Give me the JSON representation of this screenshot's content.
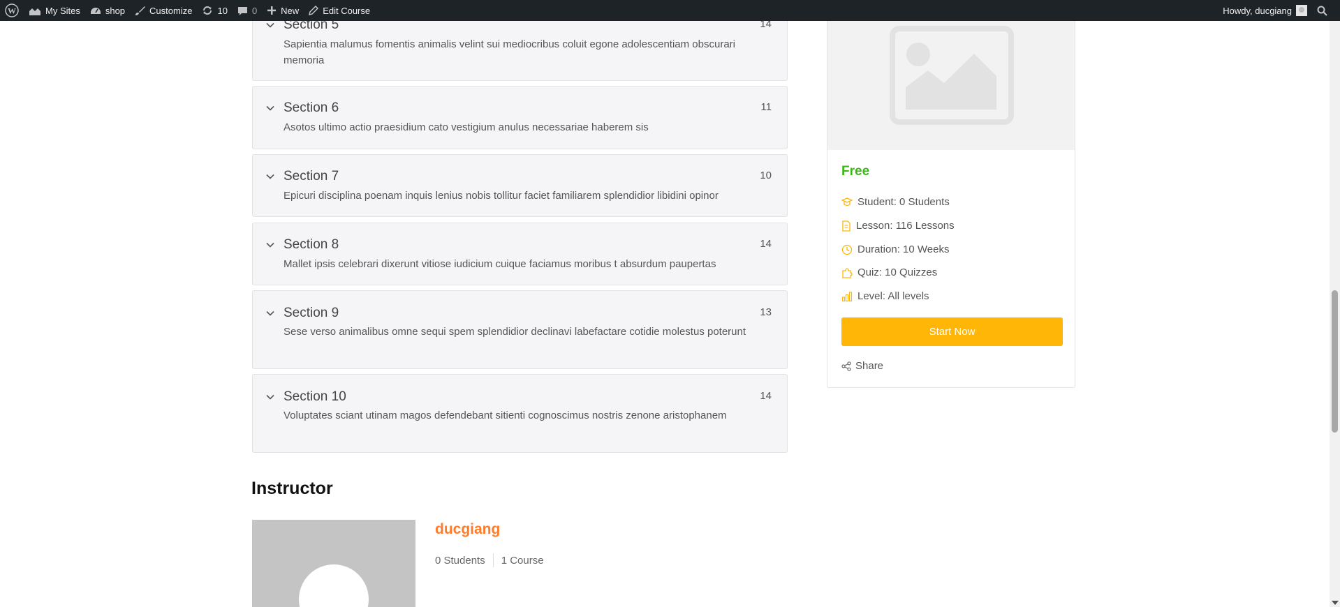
{
  "adminbar": {
    "my_sites": "My Sites",
    "site_name": "shop",
    "customize": "Customize",
    "updates_count": "10",
    "comments_count": "0",
    "new": "New",
    "edit_course": "Edit Course",
    "howdy": "Howdy, ducgiang"
  },
  "sections": [
    {
      "title": "Section 5",
      "count": "14",
      "description": "Sapientia malumus fomentis animalis velint sui mediocribus coluit egone adolescentiam obscurari memoria"
    },
    {
      "title": "Section 6",
      "count": "11",
      "description": "Asotos ultimo actio praesidium cato vestigium anulus necessariae haberem sis"
    },
    {
      "title": "Section 7",
      "count": "10",
      "description": "Epicuri disciplina poenam inquis lenius nobis tollitur faciet familiarem splendidior libidini opinor"
    },
    {
      "title": "Section 8",
      "count": "14",
      "description": "Mallet ipsis celebrari dixerunt vitiose iudicium cuique faciamus moribus t absurdum paupertas"
    },
    {
      "title": "Section 9",
      "count": "13",
      "description": "Sese verso animalibus omne sequi spem splendidior declinavi labefactare cotidie molestus poterunt"
    },
    {
      "title": "Section 10",
      "count": "14",
      "description": "Voluptates sciant utinam magos defendebant sitienti cognoscimus nostris zenone aristophanem"
    }
  ],
  "course_card": {
    "price": "Free",
    "student": "Student: 0 Students",
    "lesson": "Lesson: 116 Lessons",
    "duration": "Duration: 10 Weeks",
    "quiz": "Quiz: 10 Quizzes",
    "level": "Level: All levels",
    "start_button": "Start Now",
    "share": "Share"
  },
  "instructor": {
    "heading": "Instructor",
    "name": "ducgiang",
    "students": "0 Students",
    "courses": "1 Course"
  },
  "colors": {
    "accent": "#ffb606",
    "price": "#3cb815",
    "instructor_name": "#ff7c2a",
    "adminbar": "#1d2327"
  }
}
